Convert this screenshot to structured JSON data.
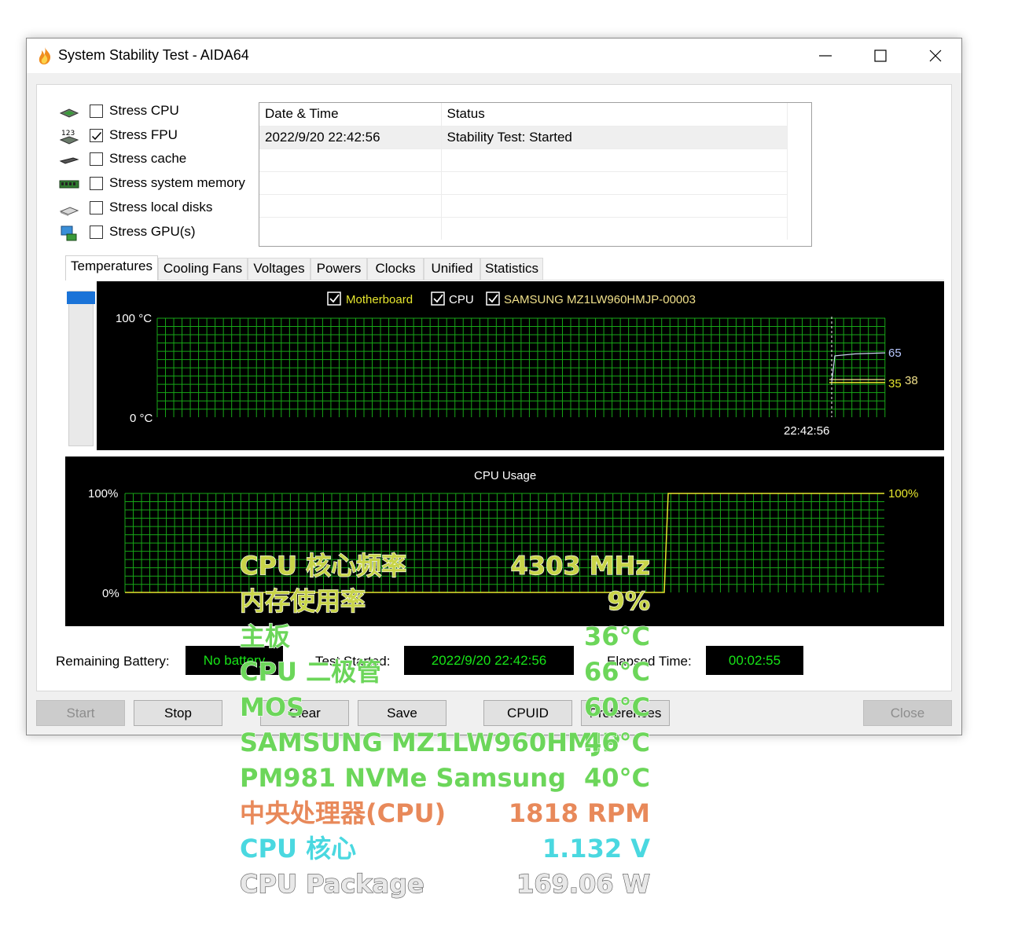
{
  "window": {
    "title": "System Stability Test - AIDA64"
  },
  "stress": [
    {
      "label": "Stress CPU",
      "checked": false,
      "icon": "cpu-chip-icon"
    },
    {
      "label": "Stress FPU",
      "checked": true,
      "icon": "fpu-123-icon"
    },
    {
      "label": "Stress cache",
      "checked": false,
      "icon": "cache-chip-icon"
    },
    {
      "label": "Stress system memory",
      "checked": false,
      "icon": "memory-module-icon"
    },
    {
      "label": "Stress local disks",
      "checked": false,
      "icon": "disk-drive-icon"
    },
    {
      "label": "Stress GPU(s)",
      "checked": false,
      "icon": "gpu-monitor-icon"
    }
  ],
  "log": {
    "headers": [
      "Date & Time",
      "Status"
    ],
    "rows": [
      [
        "2022/9/20 22:42:56",
        "Stability Test: Started"
      ]
    ]
  },
  "tabs": [
    "Temperatures",
    "Cooling Fans",
    "Voltages",
    "Powers",
    "Clocks",
    "Unified",
    "Statistics"
  ],
  "temp_chart": {
    "legend": [
      "Motherboard",
      "CPU",
      "SAMSUNG MZ1LW960HMJP-00003"
    ],
    "ylabel_top": "100 °C",
    "ylabel_bottom": "0 °C",
    "time_label": "22:42:56",
    "value_labels": {
      "cpu": "65",
      "motherboard": "35",
      "ssd": "38"
    },
    "colors": {
      "grid": "#17a617",
      "motherboard": "#e6e62e",
      "cpu": "#c8d4f0",
      "ssd": "#f0e08a",
      "label_cpu": "#b8c8ff",
      "label_mb": "#e6e62e"
    }
  },
  "cpu_chart": {
    "title": "CPU Usage",
    "ylabel_top": "100%",
    "ylabel_bottom": "0%",
    "value_label": "100%",
    "color": "#e6e62e"
  },
  "chart_data": [
    {
      "type": "line",
      "title": "",
      "xlabel": "",
      "ylabel": "",
      "ylim": [
        0,
        100
      ],
      "x_marker": "22:42:56",
      "series": [
        {
          "name": "Motherboard",
          "values": [
            35,
            35,
            35,
            35
          ]
        },
        {
          "name": "CPU",
          "values": [
            35,
            62,
            64,
            65
          ]
        },
        {
          "name": "SAMSUNG MZ1LW960HMJP-00003",
          "values": [
            38,
            38,
            38,
            38
          ]
        }
      ],
      "grid": true,
      "legend": "top-center"
    },
    {
      "type": "line",
      "title": "CPU Usage",
      "ylim": [
        0,
        100
      ],
      "series": [
        {
          "name": "",
          "values": [
            0,
            0,
            100,
            100
          ]
        }
      ],
      "grid": true
    }
  ],
  "info": {
    "remaining_battery_label": "Remaining Battery:",
    "remaining_battery_value": "No battery",
    "test_started_label": "Test Started:",
    "test_started_value": "2022/9/20 22:42:56",
    "elapsed_label": "Elapsed Time:",
    "elapsed_value": "00:02:55"
  },
  "buttons": {
    "start": "Start",
    "stop": "Stop",
    "clear": "Clear",
    "save": "Save",
    "cpuid": "CPUID",
    "preferences": "Preferences",
    "close": "Close"
  },
  "osd": [
    {
      "label": "CPU 核心频率",
      "value": "4303 MHz",
      "color": "#c8d448"
    },
    {
      "label": "内存使用率",
      "value": "9%",
      "color": "#c8d448"
    },
    {
      "label": "主板",
      "value": "36°C",
      "color": "#6cd65a"
    },
    {
      "label": "CPU 二极管",
      "value": "66°C",
      "color": "#6cd65a"
    },
    {
      "label": "MOS",
      "value": "60°C",
      "color": "#6cd65a"
    },
    {
      "label": "SAMSUNG MZ1LW960HMJP",
      "value": "46°C",
      "color": "#6cd65a"
    },
    {
      "label": "PM981 NVMe Samsung",
      "value": "40°C",
      "color": "#6cd65a"
    },
    {
      "label": "中央处理器(CPU)",
      "value": "1818 RPM",
      "color": "#e8895a"
    },
    {
      "label": "CPU 核心",
      "value": "1.132 V",
      "color": "#4ad8e0"
    },
    {
      "label": "CPU Package",
      "value": "169.06 W",
      "color": "#e8e8e8"
    }
  ]
}
